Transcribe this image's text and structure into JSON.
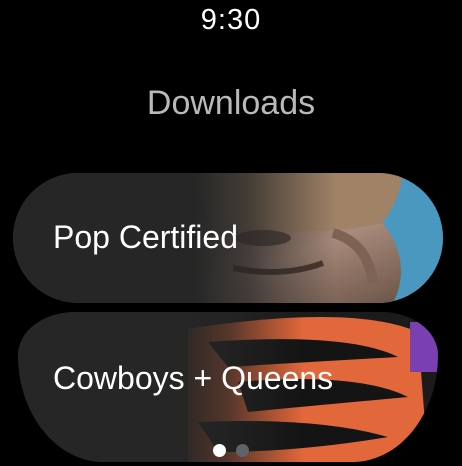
{
  "status": {
    "time": "9:30"
  },
  "header": {
    "title": "Downloads"
  },
  "playlists": [
    {
      "label": "Pop Certified"
    },
    {
      "label": "Cowboys + Queens"
    }
  ],
  "pager": {
    "count": 2,
    "active_index": 0
  },
  "colors": {
    "background": "#000000",
    "card": "#262626",
    "title": "#b9b9bb",
    "text": "#ffffff",
    "dot_active": "#ffffff",
    "dot_inactive": "#5f6368",
    "art1_sky": "#4a97bf",
    "art2_orange": "#e2673a",
    "art2_purple": "#7a3fb0"
  }
}
